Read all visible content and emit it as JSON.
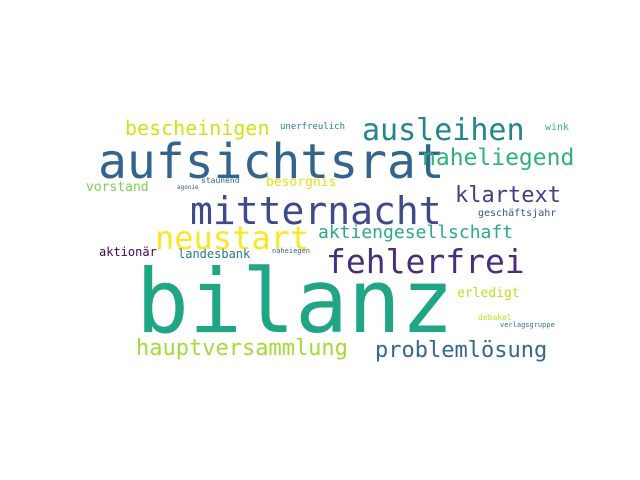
{
  "words": [
    {
      "text": "bilanz",
      "color": "#21a685"
    },
    {
      "text": "aufsichtsrat",
      "color": "#32648e"
    },
    {
      "text": "mitternacht",
      "color": "#3e4a89"
    },
    {
      "text": "fehlerfrei",
      "color": "#472f7d"
    },
    {
      "text": "ausleihen",
      "color": "#25858e"
    },
    {
      "text": "neustart",
      "color": "#fde725"
    },
    {
      "text": "naheliegend",
      "color": "#2db27d"
    },
    {
      "text": "hauptversammlung",
      "color": "#a5db36"
    },
    {
      "text": "problemlösung",
      "color": "#31688e"
    },
    {
      "text": "bescheinigen",
      "color": "#d0e11c"
    },
    {
      "text": "klartext",
      "color": "#433e85"
    },
    {
      "text": "aktiengesellschaft",
      "color": "#27ad81"
    },
    {
      "text": "vorstand",
      "color": "#7ad151"
    },
    {
      "text": "besorgnis",
      "color": "#dde318"
    },
    {
      "text": "erledigt",
      "color": "#bddf26"
    },
    {
      "text": "landesbank",
      "color": "#2a788e"
    },
    {
      "text": "aktionär",
      "color": "#440154"
    },
    {
      "text": "geschäftsjahr",
      "color": "#3b528b"
    },
    {
      "text": "unerfreulich",
      "color": "#26828e"
    },
    {
      "text": "wink",
      "color": "#35b779"
    },
    {
      "text": "staunend",
      "color": "#31688e"
    },
    {
      "text": "naheiegen",
      "color": "#34618d"
    },
    {
      "text": "agonie",
      "color": "#3b528b"
    },
    {
      "text": "debakel",
      "color": "#c2df23"
    },
    {
      "text": "verlagsgruppe",
      "color": "#2c738e"
    }
  ]
}
